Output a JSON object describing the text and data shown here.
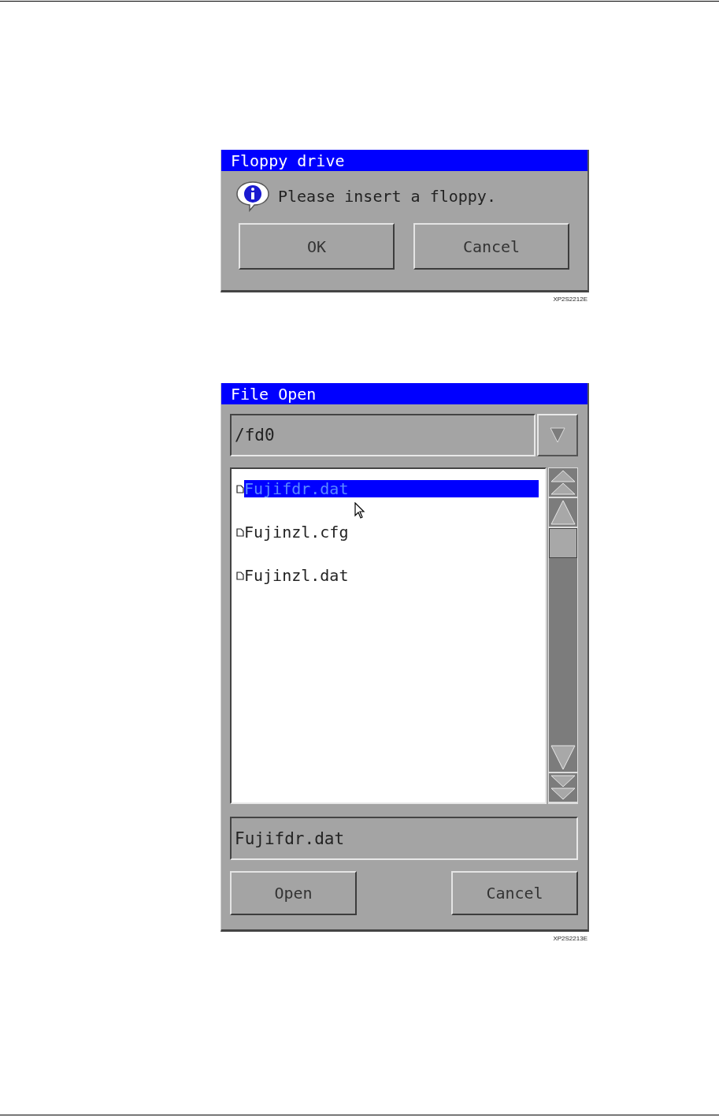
{
  "floppy_dialog": {
    "title": "Floppy drive",
    "message": "Please insert a floppy.",
    "buttons": [
      "OK",
      "Cancel"
    ],
    "figure_code": "XP2S2212E"
  },
  "file_open_dialog": {
    "title": "File Open",
    "directory": "/fd0",
    "files": [
      {
        "name": "Fujifdr.dat",
        "selected": true
      },
      {
        "name": "Fujinzl.cfg",
        "selected": false
      },
      {
        "name": "Fujinzl.dat",
        "selected": false
      }
    ],
    "file_name": "Fujifdr.dat",
    "buttons": [
      "Open",
      "Cancel"
    ],
    "figure_code": "XP2S2213E"
  }
}
